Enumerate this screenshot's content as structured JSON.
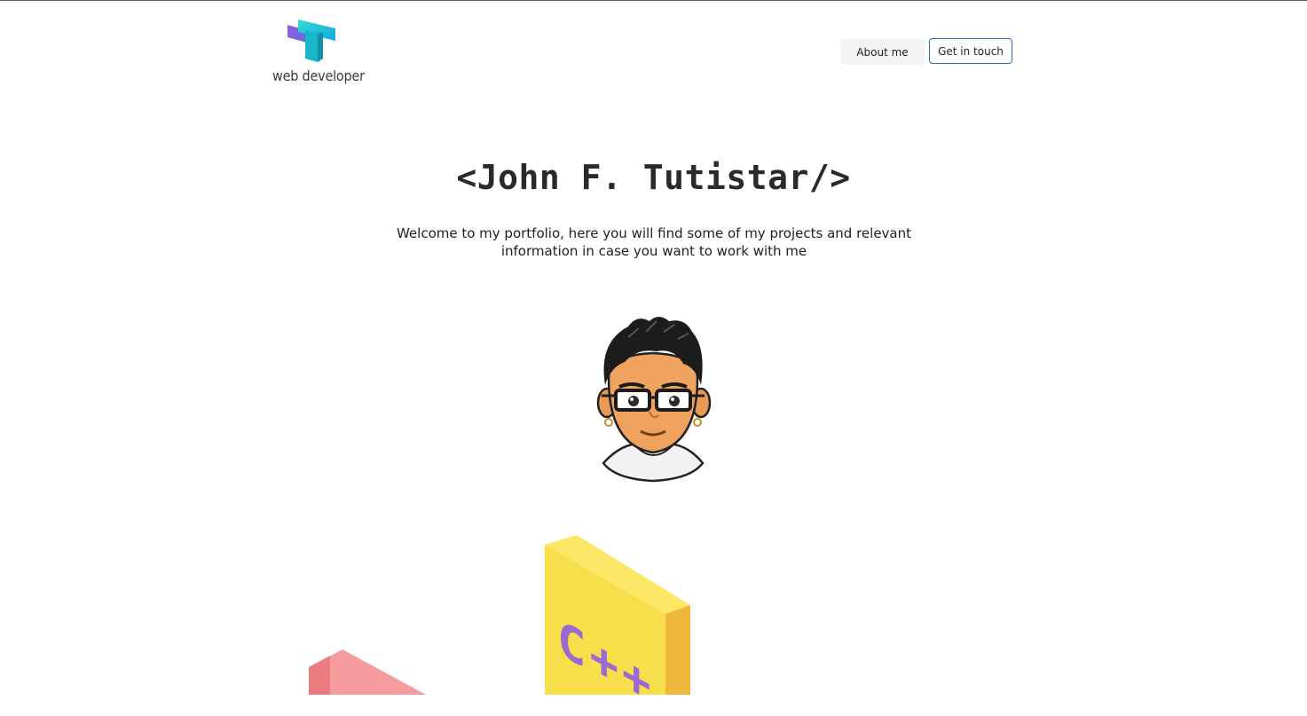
{
  "header": {
    "logo_text": "web developer",
    "logo_icon": "t-logo-icon",
    "nav": {
      "about_label": "About me",
      "contact_label": "Get in touch"
    }
  },
  "hero": {
    "title": "<John F. Tutistar/>",
    "subtitle": "Welcome to my portfolio, here you will find some of my projects and relevant information in case you want to work with me"
  },
  "illustration": {
    "avatar": "bitmoji-avatar",
    "block_label": "C++",
    "block_color": "#f6df4a",
    "block_text_color": "#9b6ad1",
    "second_block_color": "#f28b8f"
  },
  "colors": {
    "accent": "#2b6cb0",
    "logo_gradient_start": "#8b5cf6",
    "logo_gradient_end": "#14c8c8"
  }
}
